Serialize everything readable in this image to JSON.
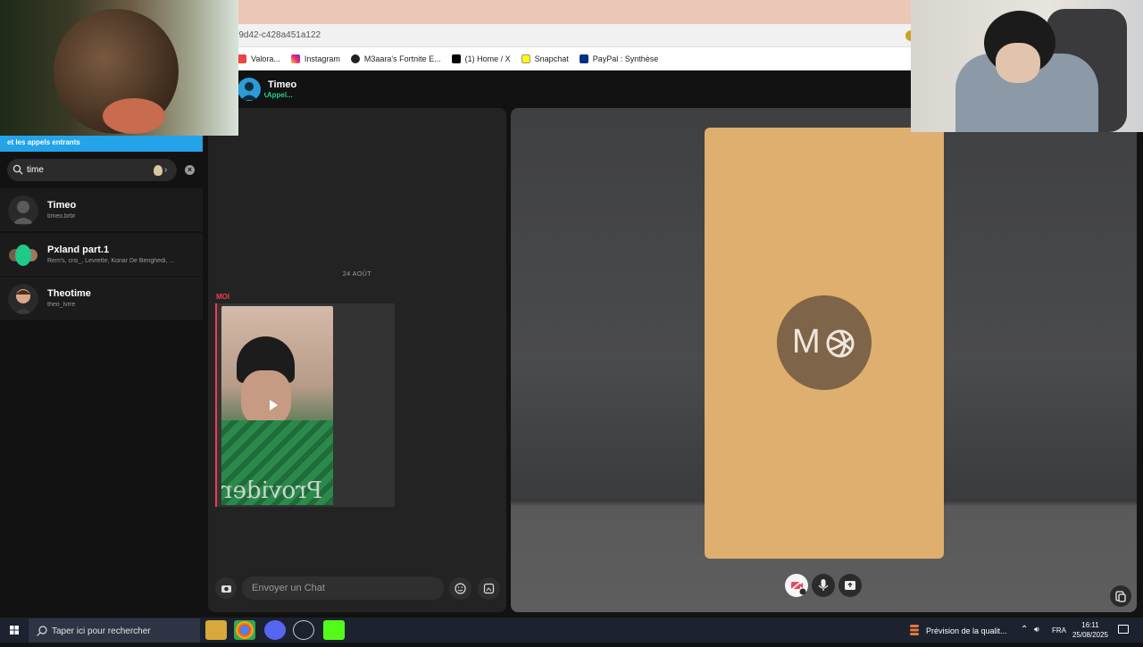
{
  "browser": {
    "url_fragment": "-9d42-c428a451a122",
    "bookmarks": [
      {
        "label": "Valora...",
        "color": "#e84545"
      },
      {
        "label": "Instagram",
        "color": "#d62976"
      },
      {
        "label": "M3aara's Fortnite E...",
        "color": "#222222"
      },
      {
        "label": "(1) Home / X",
        "color": "#000000"
      },
      {
        "label": "Snapchat",
        "color": "#fffc00"
      },
      {
        "label": "PayPal : Synthèse",
        "color": "#003087"
      }
    ]
  },
  "sidebar": {
    "promo_text": "et les appels entrants",
    "search_value": "time",
    "contacts": [
      {
        "name": "Timeo",
        "sub": "timeo.brbr"
      },
      {
        "name": "Pxland part.1",
        "sub": "Rem's, cris_, Levrette, Konar De Benghedi, ..."
      },
      {
        "name": "Theotime",
        "sub": "theo_lvrre"
      }
    ]
  },
  "chat": {
    "name": "Timeo",
    "status": "Appel...",
    "date_separator": "24 AOÛT",
    "sender_label": "MOI",
    "video_caption_text": "Provider",
    "composer_placeholder": "Envoyer un Chat"
  },
  "call": {
    "avatar_initial": "M"
  },
  "taskbar": {
    "search_placeholder": "Taper ici pour rechercher",
    "weather_text": "Prévision de la qualit...",
    "lang": "FRA",
    "time": "16:11",
    "date": "25/08/2025"
  },
  "colors": {
    "snap_accent": "#20d187",
    "me_red": "#f23c57",
    "call_card": "#deaf6e",
    "promo_blue": "#23a3e8"
  }
}
